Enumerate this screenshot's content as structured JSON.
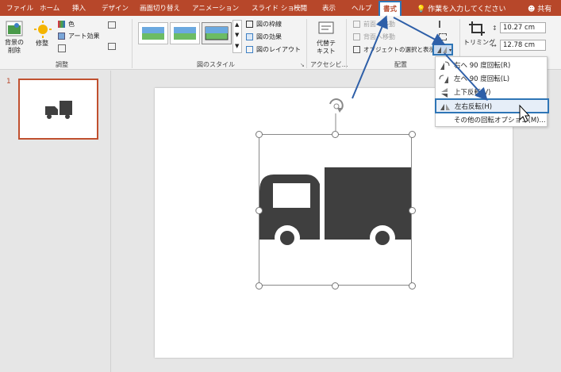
{
  "tabs": [
    {
      "label": "ファイル"
    },
    {
      "label": "ホーム"
    },
    {
      "label": "挿入"
    },
    {
      "label": "デザイン"
    },
    {
      "label": "画面切り替え"
    },
    {
      "label": "アニメーション"
    },
    {
      "label": "スライド ショー"
    },
    {
      "label": "校閲"
    },
    {
      "label": "表示"
    },
    {
      "label": "ヘルプ"
    },
    {
      "label": "書式"
    }
  ],
  "tell_me": "作業を入力してください",
  "share": "共有",
  "ribbon": {
    "remove_bg": "背景の\n削除",
    "corrections": "修整",
    "color": "色",
    "artistic": "アート効果",
    "group_adjust": "調整",
    "border": "図の枠線",
    "effects": "図の効果",
    "layout": "図のレイアウト",
    "group_styles": "図のスタイル",
    "alt_text": "代替テ\nキスト",
    "group_access": "アクセシビ…",
    "bring_forward": "前面へ移動",
    "send_backward": "背面へ移動",
    "selection_pane": "オブジェクトの選択と表示",
    "group_arrange": "配置",
    "crop": "トリミング",
    "height": "10.27 cm",
    "width": "12.78 cm"
  },
  "slide_number": "1",
  "rotate_menu": {
    "items": [
      {
        "label": "右へ 90 度回転(R)"
      },
      {
        "label": "左へ 90 度回転(L)"
      },
      {
        "label": "上下反転(V)"
      },
      {
        "label": "左右反転(H)"
      },
      {
        "label": "その他の回転オプション(M)..."
      }
    ]
  },
  "colors": {
    "accent": "#b7472a",
    "highlight": "#2e75b6",
    "truck": "#3f3f3f"
  }
}
